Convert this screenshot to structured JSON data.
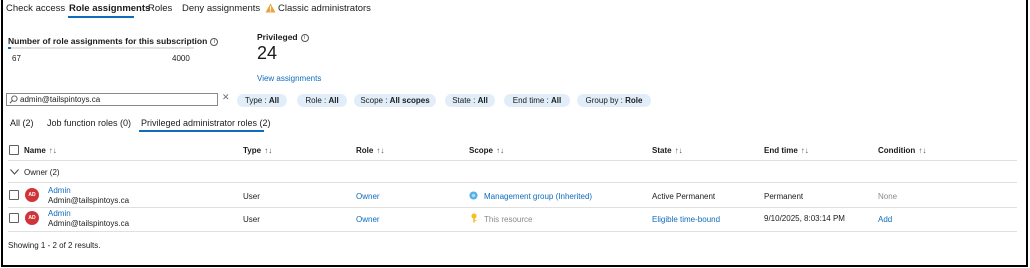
{
  "tabs": [
    {
      "label": "Check access"
    },
    {
      "label": "Role assignments"
    },
    {
      "label": "Roles"
    },
    {
      "label": "Deny assignments"
    },
    {
      "label": "Classic administrators"
    }
  ],
  "stats": {
    "count_label": "Number of role assignments for this subscription",
    "count_current": "67",
    "count_max": "4000",
    "count_fraction": 0.0168,
    "privileged_label": "Privileged",
    "privileged_value": "24",
    "view_link": "View assignments"
  },
  "search": {
    "value": "admin@tailspintoys.ca"
  },
  "filters": [
    {
      "key": "Type : ",
      "value": "All"
    },
    {
      "key": "Role : ",
      "value": "All"
    },
    {
      "key": "Scope : ",
      "value": "All scopes"
    },
    {
      "key": "State : ",
      "value": "All"
    },
    {
      "key": "End time : ",
      "value": "All"
    },
    {
      "key": "Group by : ",
      "value": "Role"
    }
  ],
  "subtabs": [
    {
      "label": "All (2)"
    },
    {
      "label": "Job function roles (0)"
    },
    {
      "label": "Privileged administrator roles (2)"
    }
  ],
  "table": {
    "headers": {
      "name": "Name",
      "type": "Type",
      "role": "Role",
      "scope": "Scope",
      "state": "State",
      "end_time": "End time",
      "condition": "Condition"
    },
    "group": "Owner (2)",
    "rows": [
      {
        "initials": "AD",
        "name": "Admin",
        "email": "Admin@tailspintoys.ca",
        "type": "User",
        "role": "Owner",
        "scope": "Management group (Inherited)",
        "state": "Active Permanent",
        "end_time": "Permanent",
        "condition": "None"
      },
      {
        "initials": "AD",
        "name": "Admin",
        "email": "Admin@tailspintoys.ca",
        "type": "User",
        "role": "Owner",
        "scope": "This resource",
        "state": "Eligible time-bound",
        "end_time": "9/10/2025, 8:03:14 PM",
        "condition": "Add"
      }
    ],
    "footer": "Showing 1 - 2 of 2 results."
  },
  "icons": {
    "warning": "warning-icon",
    "info": "info-icon",
    "search": "search-icon",
    "management_group": "management-group-icon",
    "key": "key-icon",
    "accent": "#0f6cbd",
    "avatar_color": "#d13438"
  }
}
